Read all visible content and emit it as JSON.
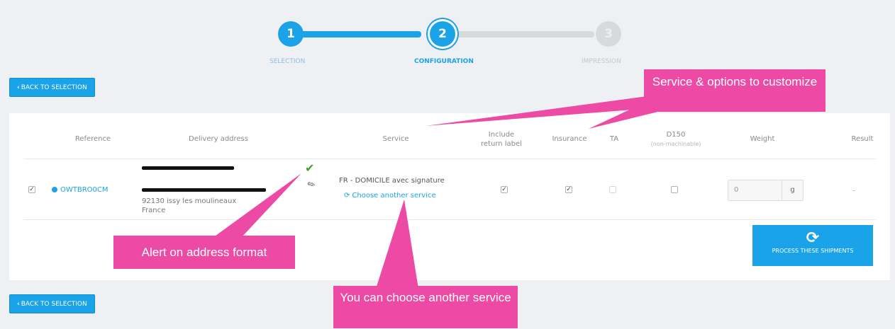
{
  "stepper": {
    "steps": [
      {
        "number": "1",
        "label": "Selection",
        "state": "done"
      },
      {
        "number": "2",
        "label": "Configuration",
        "state": "active"
      },
      {
        "number": "3",
        "label": "Impression",
        "state": "pending"
      }
    ]
  },
  "nav": {
    "back_label": "Back to selection"
  },
  "table": {
    "headers": {
      "reference": "Reference",
      "delivery_address": "Delivery address",
      "service": "Service",
      "include_return_label": "Include return label",
      "insurance": "Insurance",
      "ta": "TA",
      "d150": "D150",
      "d150_sub": "(non-machinable)",
      "weight": "Weight",
      "result": "Result"
    },
    "row": {
      "selected": true,
      "reference": "OWTBRO0CM",
      "address_line_3": "92130 issy les moulineaux",
      "address_line_4": "France",
      "service_name": "FR - DOMICILE avec signature",
      "choose_service_link": "Choose another service",
      "include_return_label": true,
      "insurance": true,
      "ta": false,
      "d150": false,
      "weight_value": "0",
      "weight_unit": "g",
      "result": "-"
    }
  },
  "process_button": {
    "label": "Process these shipments"
  },
  "callouts": {
    "service_options": "Service & options to customize",
    "address_alert": "Alert on address format",
    "choose_service": "You can choose another service"
  },
  "colors": {
    "accent": "#1aa3e8",
    "callout": "#ec4aa4",
    "ok": "#3fa12e"
  },
  "icons": [
    "check-icon",
    "pencil-icon",
    "refresh-icon",
    "sync-icon",
    "chevron-left-icon"
  ]
}
